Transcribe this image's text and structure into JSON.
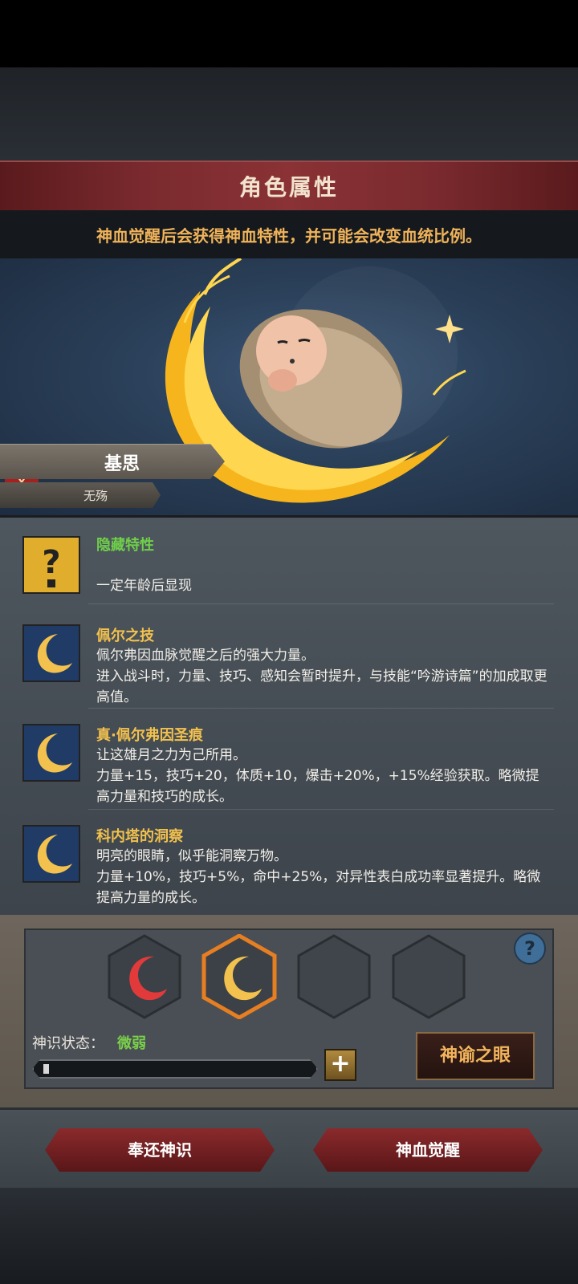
{
  "header": {
    "title": "角色属性",
    "notice": "神血觉醒后会获得神血特性，并可能会改变血统比例。"
  },
  "character": {
    "name": "基思",
    "subtitle": "无殇"
  },
  "traits": [
    {
      "icon": "question-icon",
      "title": "隐藏特性",
      "title_color": "#6fcf4a",
      "desc": "一定年龄后显现"
    },
    {
      "icon": "crescent-moon-icon",
      "title": "佩尔之技",
      "title_color": "#f2c14e",
      "desc": "佩尔弗因血脉觉醒之后的强大力量。\n进入战斗时，力量、技巧、感知会暂时提升，与技能“吟游诗篇”的加成取更高值。"
    },
    {
      "icon": "crescent-moon-icon",
      "title": "真·佩尔弗因圣痕",
      "title_color": "#f2c14e",
      "desc": "让这雄月之力为己所用。\n力量+15，技巧+20，体质+10，爆击+20%，+15%经验获取。略微提高力量和技巧的成长。"
    },
    {
      "icon": "crescent-moon-icon",
      "title": "科内塔的洞察",
      "title_color": "#f2c14e",
      "desc": "明亮的眼睛，似乎能洞察万物。\n力量+10%，技巧+5%，命中+25%，对异性表白成功率显著提升。略微提高力量的成长。"
    }
  ],
  "panel": {
    "status_label": "神识状态：",
    "status_value": "微弱",
    "progress": 0.02,
    "plus_label": "+",
    "oracle_button": "神谕之眼",
    "help_label": "?"
  },
  "buttons": {
    "return": "奉还神识",
    "awaken": "神血觉醒"
  },
  "colors": {
    "accent_gold": "#f2c14e",
    "accent_green": "#6fcf4a",
    "title_red": "#7a2a2e"
  }
}
